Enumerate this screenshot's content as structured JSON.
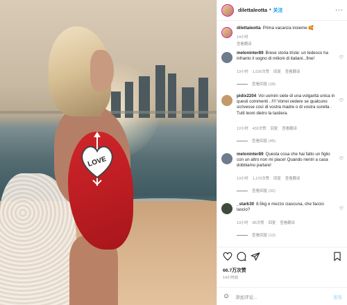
{
  "header": {
    "username": "dilettaleotta",
    "separator": "•",
    "follow_label": "关注",
    "more_label": "···"
  },
  "caption": {
    "username": "dilettaleotta",
    "text": "Prima vacanza insieme 🥰",
    "time": "14小时"
  },
  "caption_translate": "查看翻译",
  "comments": [
    {
      "username": "meloninter89",
      "text": "Breve storia triste: un tedesco ha infranto il sogno di milioni di italiani...fine!",
      "time": "13小时",
      "likes": "1,026次赞",
      "reply": "回复",
      "translate": "查看翻译",
      "view_replies": "查看回复 (18)",
      "avatar_color": "#6d7b8c"
    },
    {
      "username": "pidix2204",
      "text": "Voi uomini siete di una volgarità unica in questi commenti ..!!!! Vorrei vedere se qualcuno scrivesse così di vostra madre o di vostra sorella . Tutti leoni dietro la tastiera.",
      "time": "12小时",
      "likes": "432次赞",
      "reply": "回复",
      "translate": "查看翻译",
      "view_replies": "查看回复 (45)",
      "avatar_color": "#c49a6c"
    },
    {
      "username": "meloninter89",
      "text": "Questa cosa che hai fatto un figlio con un altro non mi piace! Quando rientri a casa dobbiamo parlare!",
      "time": "13小时",
      "likes": "1,170次赞",
      "reply": "回复",
      "translate": "查看翻译",
      "view_replies": "查看回复 (32)",
      "avatar_color": "#6d7b8c"
    },
    {
      "username": "_stark30",
      "text": "8.5kg e mezzo ciascuna, che faccio lascio?",
      "time": "13小时",
      "likes": "85次赞",
      "reply": "回复",
      "translate": "查看翻译",
      "view_replies": "查看回复 (12)",
      "avatar_color": "#3f4a3c"
    }
  ],
  "sticker_text": "LOVE",
  "likes_count": "66.7万次赞",
  "post_time": "14小时前",
  "add_comment": {
    "emoji_icon": "☺",
    "placeholder": "添加评论...",
    "post_label": "发布"
  },
  "colors": {
    "accent": "#0095f6",
    "swimsuit": "#c41f25"
  }
}
